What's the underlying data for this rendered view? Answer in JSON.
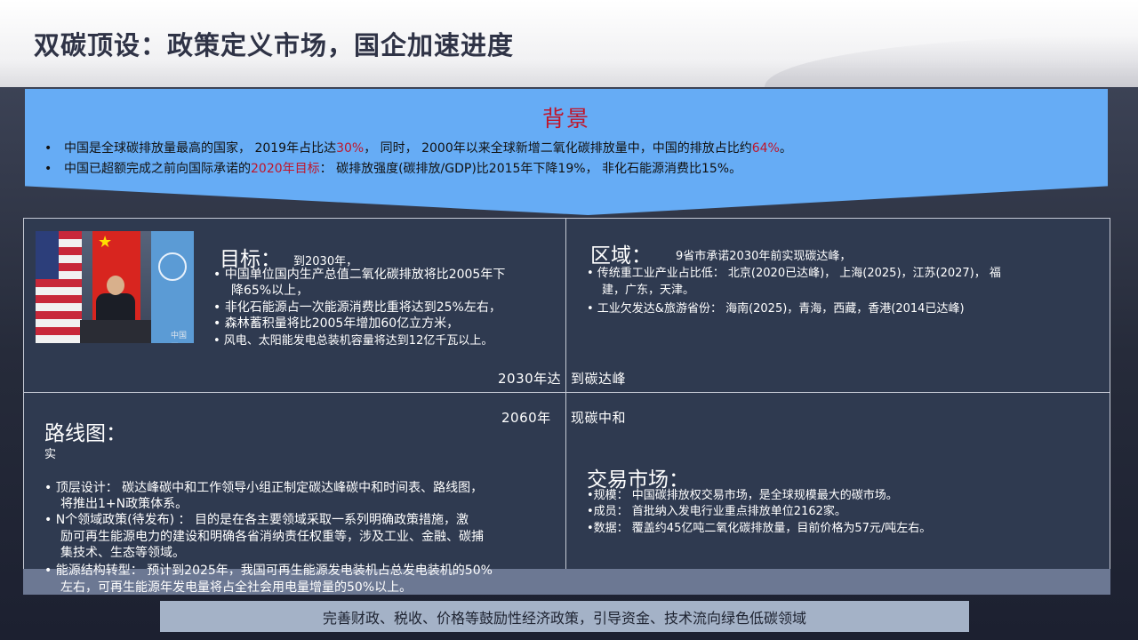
{
  "title": "双碳顶设：政策定义市场，国企加速进度",
  "background": {
    "heading": "背景",
    "line1": {
      "bullet": "•",
      "p1": "中国是全球碳排放量最高的国家，     2019年占比达",
      "r1": "30%",
      "p2": "，  同时，     2000年以来全球新增二氧化碳排放量中，中国的排放占比约",
      "r2": "64%",
      "p3": "。"
    },
    "line2": {
      "bullet": "•",
      "p1": "中国已超额完成之前向国际承诺的",
      "r1": "2020年目标",
      "p2": "：  碳排放强度(碳排放/GDP)比2015年下降19%，   非化石能源消费比15%。"
    }
  },
  "goal": {
    "title": "目标：",
    "subtitle": "到2030年，",
    "items": [
      "•   中国单位国内生产总值二氧化碳排放将比2005年下",
      "降65%以上，",
      "• 非化石能源占一次能源消费比重将达到25%左右，",
      "• 森林蓄积量将比2005年增加60亿立方米，",
      "•      风电、太阳能发电总装机容量将达到12亿千瓦以上。"
    ],
    "photo_watermark": "中国网"
  },
  "region": {
    "title": "区域：",
    "subtitle": "9省市承诺2030年前实现碳达峰，",
    "items": [
      "• 传统重工业产业占比低：    北京(2020已达峰)，     上海(2025)，江苏(2027)，     福",
      "建，广东，天津。",
      "•  工业欠发达&旅游省份：     海南(2025)，青海，西藏，香港(2014已达峰)"
    ]
  },
  "milestones": {
    "peak_left": "2030年达",
    "peak_right": "到碳达峰",
    "neutral_left": "2060年",
    "neutral_right": "现碳中和"
  },
  "roadmap": {
    "title": "路线图：",
    "subtitle": "实",
    "items": [
      "• 顶层设计：    碳达峰碳中和工作领导小组正制定碳达峰碳中和时间表、路线图，",
      "将推出1+N政策体系。",
      "•   N个领域政策(待发布)   ：    目的是在各主要领域采取一系列明确政策措施，激",
      "励可再生能源电力的建设和明确各省消纳责任权重等，涉及工业、金融、碳捕",
      "集技术、生态等领域。",
      "• 能源结构转型：    预计到2025年，我国可再生能源发电装机占总发电装机的50%",
      "左右，可再生能源年发电量将占全社会用电量增量的50%以上。"
    ]
  },
  "market": {
    "title": "交易市场：",
    "items": [
      "•规模：    中国碳排放权交易市场，是全球规模最大的碳市场。",
      "•成员：    首批纳入发电行业重点排放单位2162家。",
      "•数据：    覆盖约45亿吨二氧化碳排放量，目前价格为57元/吨左右。"
    ]
  },
  "footer": "完善财政、税收、价格等鼓励性经济政策，引导资金、技术流向绿色低碳领域"
}
